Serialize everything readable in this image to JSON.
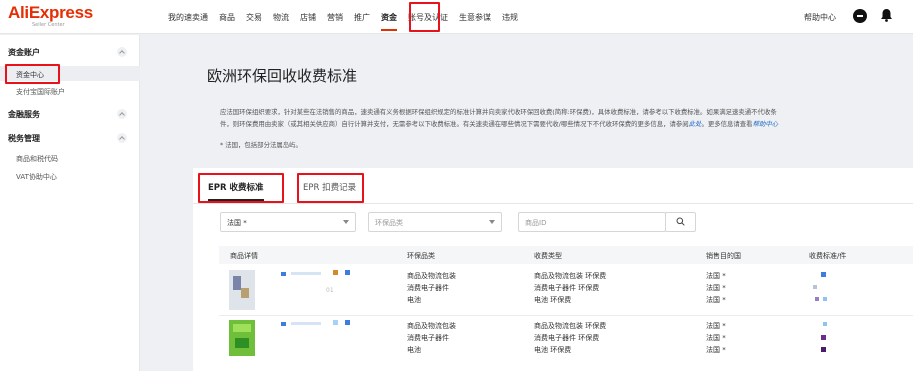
{
  "brand": {
    "name": "AliExpress",
    "subtitle": "Seller Center"
  },
  "topnav": {
    "items": [
      "我的速卖通",
      "商品",
      "交易",
      "物流",
      "店铺",
      "营销",
      "推广",
      "资金",
      "账号及认证",
      "生意参谋",
      "违规"
    ],
    "active_index": 7,
    "help": "帮助中心"
  },
  "sidebar": {
    "groups": [
      {
        "label": "资金账户",
        "items": [
          "资金中心",
          "支付宝国际账户"
        ]
      },
      {
        "label": "金融服务",
        "items": []
      },
      {
        "label": "税务管理",
        "items": [
          "商品和税代码",
          "VAT协助中心"
        ]
      }
    ],
    "active_item": "资金中心"
  },
  "main": {
    "title": "欧洲环保回收收费标准",
    "desc_1": "应法国环保组织要求，针对某些在法销售的商品，速卖通有义务根据环保组织规定的标准计算并向卖家代收环保回收费(简称:环保费)，具体收费标准，请参考以下收费标准。如果满足速卖通不代收条",
    "desc_2": "件，则环保费用由卖家（或其相关供应商）自行计算并支付，无需参考以下收费标准。有关速卖通在哪些情况下需要代收/哪些情况下不代收环保费的更多信息，请参阅",
    "desc_link1": "此处",
    "desc_3": "。更多信息请查看",
    "desc_link2": "帮助中心",
    "note": "* 法国，包括部分法属岛屿。"
  },
  "tabs": [
    "EPR 收费标准",
    "EPR 扣费记录"
  ],
  "filters": {
    "country": "法国 *",
    "category_placeholder": "环保品类",
    "product_id_placeholder": "商品ID"
  },
  "table": {
    "headers": [
      "商品详情",
      "环保品类",
      "收费类型",
      "销售目的国",
      "收费标准/件"
    ],
    "rows": [
      {
        "product_id_partial": "01",
        "categories": [
          "商品及物流包装",
          "消费电子器件",
          "电池"
        ],
        "fee_types": [
          "商品及物流包装 环保费",
          "消费电子器件 环保费",
          "电池 环保费"
        ],
        "countries": [
          "法国 *",
          "法国 *",
          "法国 *"
        ]
      },
      {
        "categories": [
          "商品及物流包装",
          "消费电子器件",
          "电池"
        ],
        "fee_types": [
          "商品及物流包装 环保费",
          "消费电子器件 环保费",
          "电池 环保费"
        ],
        "countries": [
          "法国 *",
          "法国 *",
          "法国 *"
        ]
      }
    ]
  },
  "colors": {
    "accent": "#e62e04",
    "highlight_box": "#e8121a",
    "link": "#1a66c7"
  }
}
